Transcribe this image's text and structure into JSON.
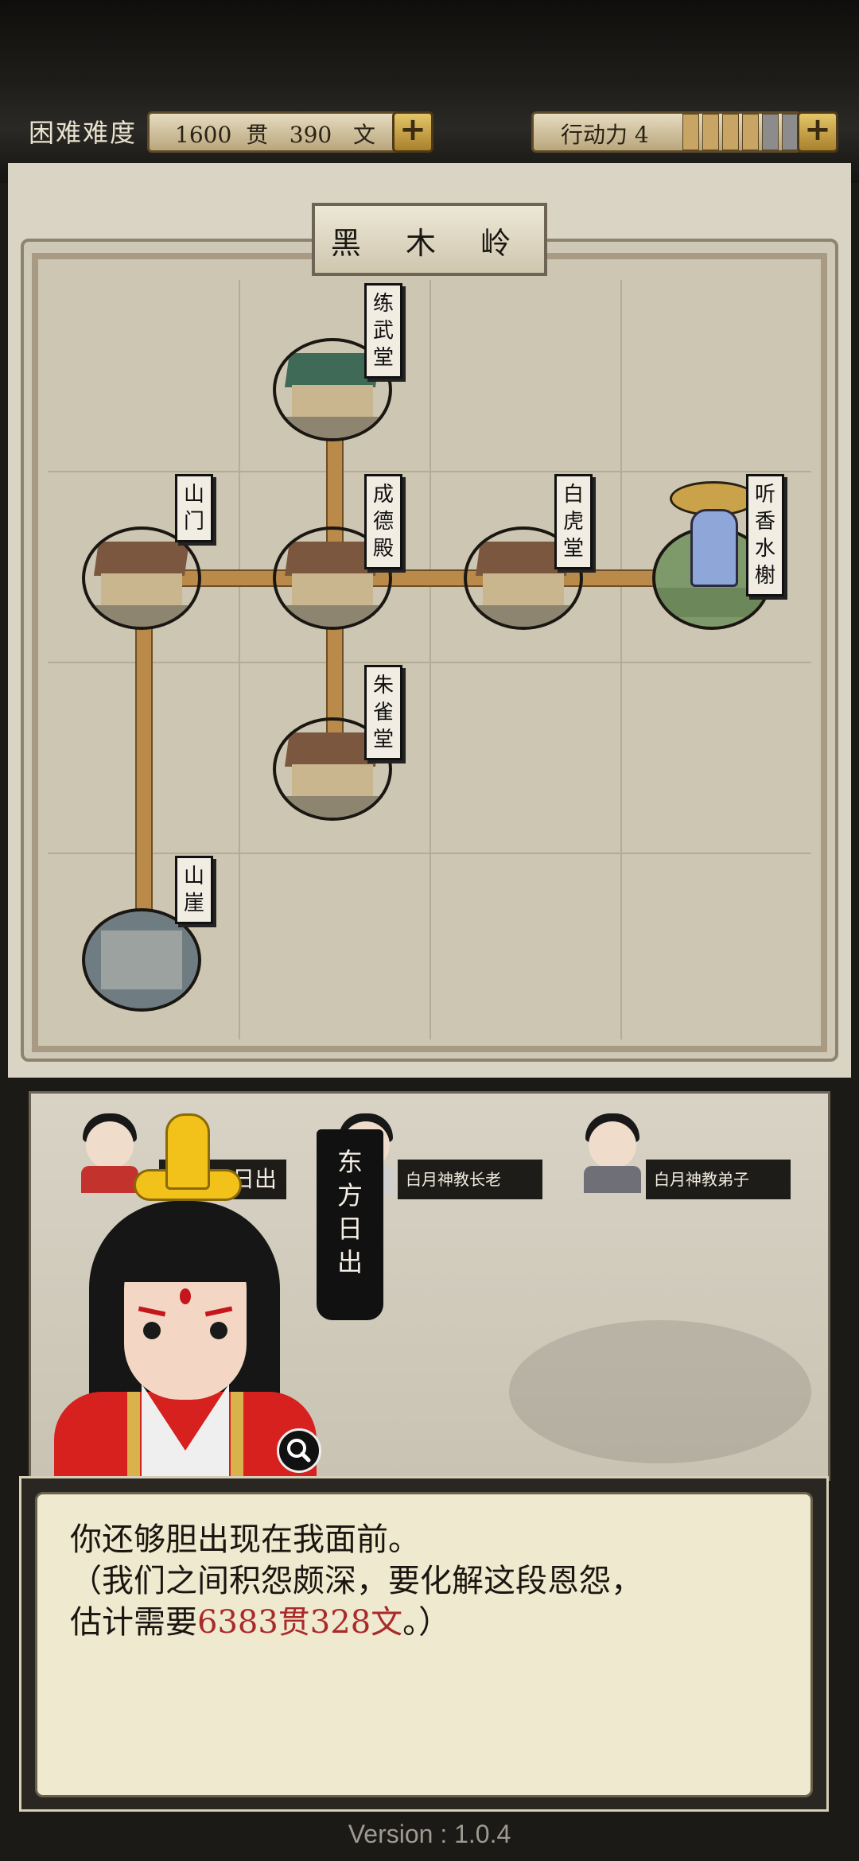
{
  "header": {
    "difficulty": "困难难度",
    "currency": {
      "guan_value": "1600",
      "guan_unit": "贯",
      "wen_value": "390",
      "wen_unit": "文"
    },
    "action_points": {
      "label": "行动力 4",
      "filled": 4,
      "max": 6
    }
  },
  "map": {
    "title": "黑 木 岭",
    "locations": [
      {
        "id": "lianwutang",
        "label": "练武堂"
      },
      {
        "id": "shanmen",
        "label": "山门"
      },
      {
        "id": "chengdedian",
        "label": "成德殿"
      },
      {
        "id": "baihutang",
        "label": "白虎堂"
      },
      {
        "id": "tingxiangshuixie",
        "label": "听香水榭"
      },
      {
        "id": "zhuquetang",
        "label": "朱雀堂"
      },
      {
        "id": "shanya",
        "label": "山崖"
      }
    ]
  },
  "npcs": [
    {
      "label": "日出"
    },
    {
      "label": "白月神教长老"
    },
    {
      "label": "白月神教弟子"
    }
  ],
  "speaker": {
    "name": "东方日出"
  },
  "dialog": {
    "line1": "你还够胆出现在我面前。",
    "line2": "（我们之间积怨颇深，要化解这段恩怨，",
    "line3_prefix": "估计需要",
    "line3_amount": "6383贯328文",
    "line3_suffix": "。）"
  },
  "footer": {
    "version": "Version : 1.0.4"
  }
}
